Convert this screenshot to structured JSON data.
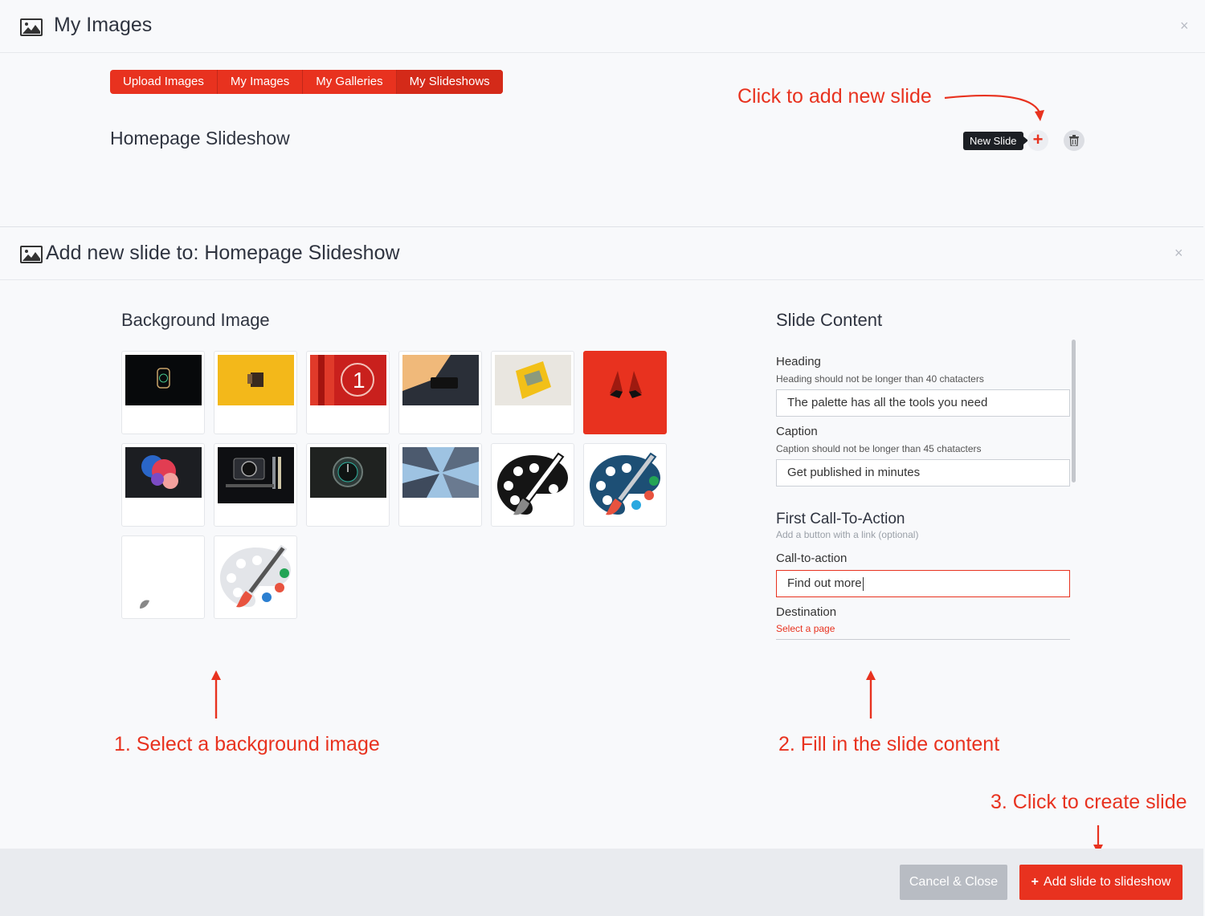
{
  "top_window": {
    "title": "My Images",
    "close": "×",
    "tabs": [
      {
        "label": "Upload Images"
      },
      {
        "label": "My Images"
      },
      {
        "label": "My Galleries"
      },
      {
        "label": "My Slideshows",
        "active": true
      }
    ],
    "slideshow_title": "Homepage Slideshow",
    "tooltip": "New Slide",
    "new_slide_icon": "plus-icon",
    "delete_icon": "trash-icon"
  },
  "annotations": {
    "add_slide": "Click to add new slide",
    "step1": "1. Select a background image",
    "step2": "2. Fill in the slide content",
    "step3": "3. Click to create slide"
  },
  "modal": {
    "title": "Add new slide to: Homepage Slideshow",
    "close": "×",
    "background_section": {
      "title": "Background Image",
      "images": [
        {
          "name": "smartwatch-dark",
          "selected": false
        },
        {
          "name": "camera-on-yellow",
          "selected": false
        },
        {
          "name": "red-number-one",
          "selected": false
        },
        {
          "name": "phone-on-desk",
          "selected": false
        },
        {
          "name": "yellow-casio-watch",
          "selected": false
        },
        {
          "name": "red-shoes-on-red",
          "selected": true
        },
        {
          "name": "colorful-smoke",
          "selected": false
        },
        {
          "name": "camera-gear-flatlay",
          "selected": false
        },
        {
          "name": "watch-dial-dark",
          "selected": false
        },
        {
          "name": "skyscrapers-looking-up",
          "selected": false
        },
        {
          "name": "palette-black",
          "selected": false
        },
        {
          "name": "palette-blue",
          "selected": false
        },
        {
          "name": "blank-image",
          "selected": false
        },
        {
          "name": "palette-light",
          "selected": false
        }
      ]
    },
    "content_section": {
      "title": "Slide Content",
      "heading_label": "Heading",
      "heading_hint": "Heading should not be longer than 40 chatacters",
      "heading_value": "The palette has all the tools you need",
      "caption_label": "Caption",
      "caption_hint": "Caption should not be longer than 45 chatacters",
      "caption_value": "Get published in minutes",
      "cta_title": "First Call-To-Action",
      "cta_hint": "Add a button with a link (optional)",
      "cta_label": "Call-to-action",
      "cta_value": "Find out more",
      "destination_label": "Destination",
      "destination_link": "Select a page"
    },
    "footer": {
      "cancel_label": "Cancel & Close",
      "add_plus": "+",
      "add_label": "Add slide to slideshow"
    }
  },
  "colors": {
    "accent": "#e8321f",
    "dark": "#2f3440",
    "background": "#f8f9fb",
    "footer": "#e9ebef"
  }
}
